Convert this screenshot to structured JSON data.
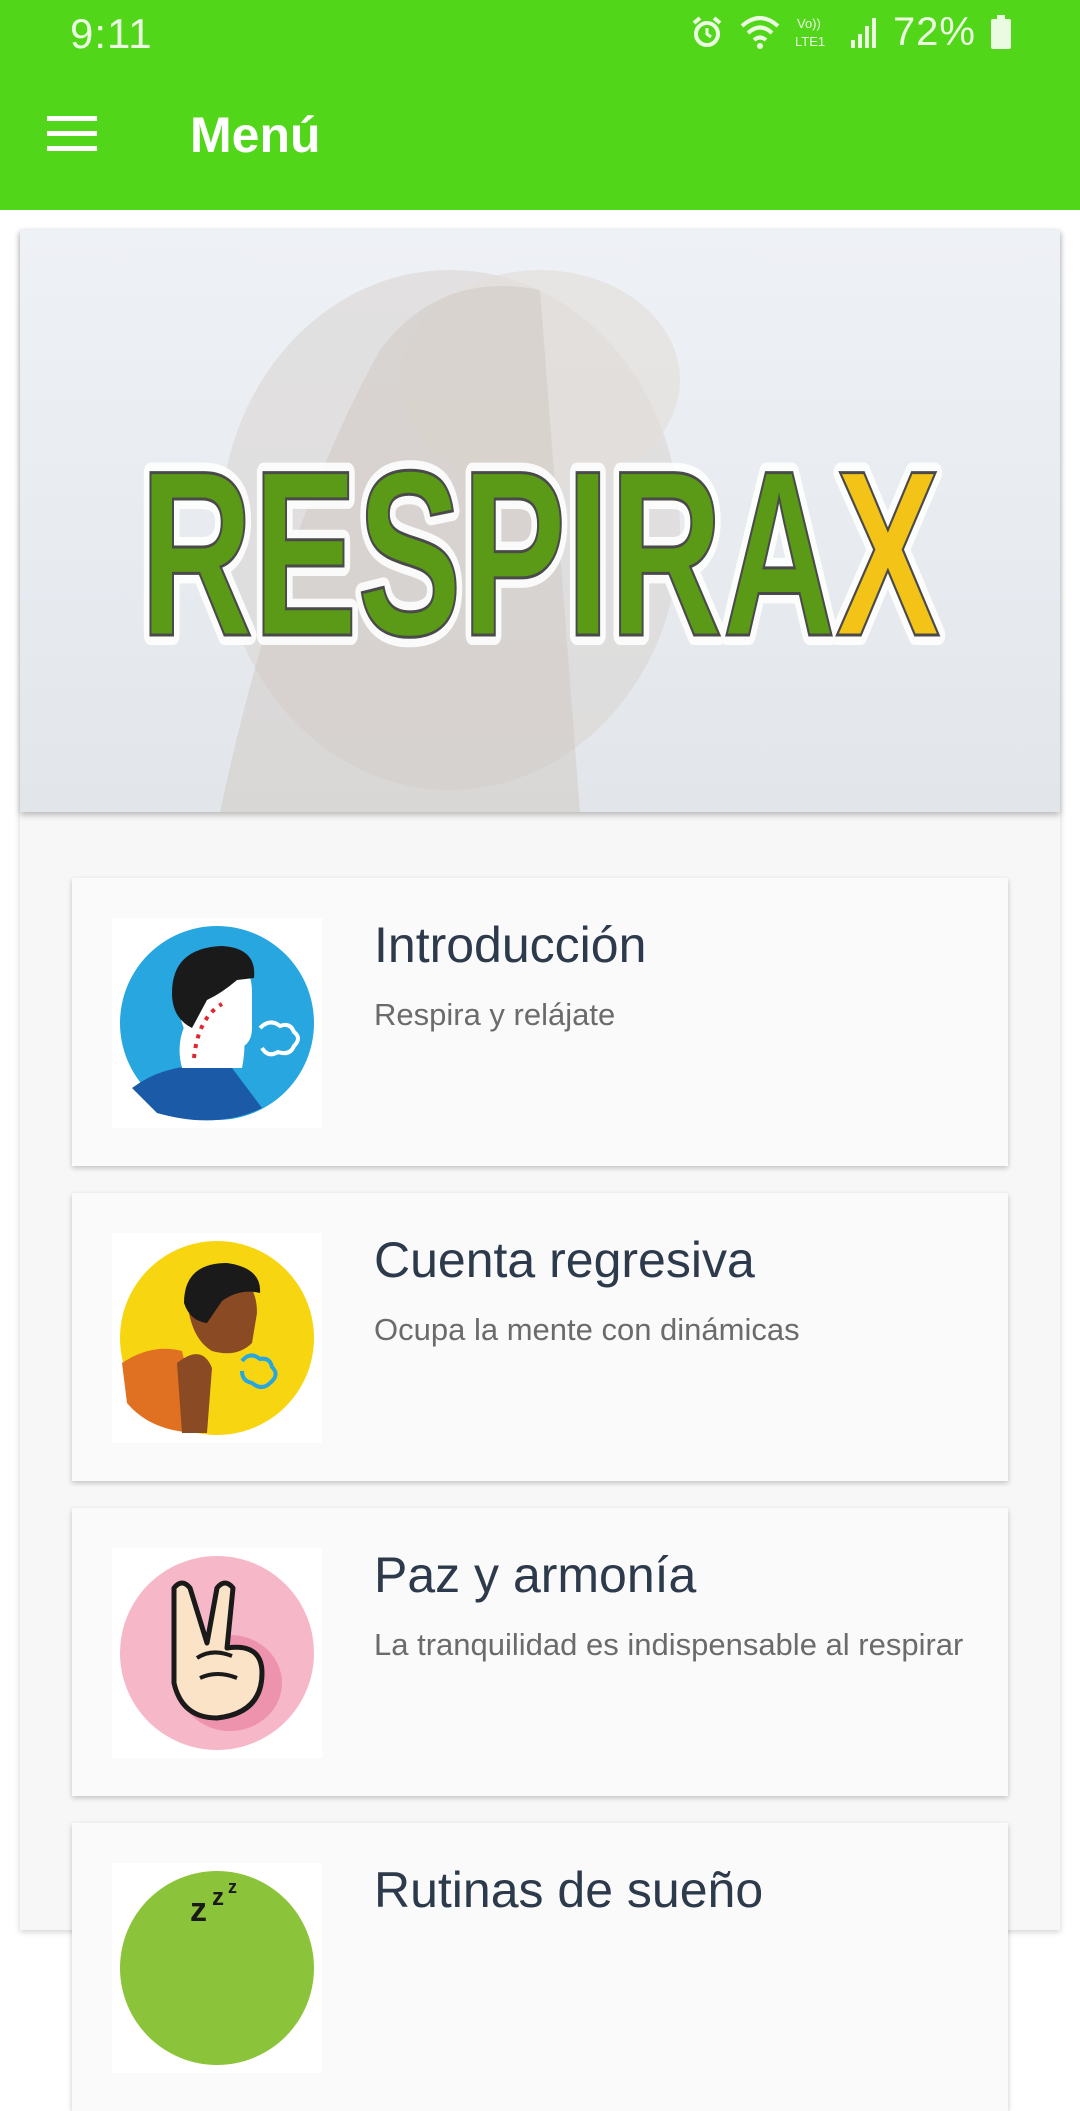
{
  "status_bar": {
    "time": "9:11",
    "battery": "72%",
    "network_label": "Vo)) LTE1",
    "icons": [
      "alarm-icon",
      "wifi-icon",
      "volte-icon",
      "signal-icon",
      "battery-icon"
    ]
  },
  "app_bar": {
    "title": "Menú",
    "menu_icon": "hamburger-menu-icon"
  },
  "banner": {
    "logo_text_green": "RESPIRA",
    "logo_text_yellow": "X",
    "colors": {
      "green": "#5a9a16",
      "yellow": "#f3c417"
    }
  },
  "menu_items": [
    {
      "title": "Introducción",
      "subtitle": "Respira y relájate",
      "icon": "person-exhaling-icon",
      "icon_bg": "#27a6e0"
    },
    {
      "title": "Cuenta regresiva",
      "subtitle": "Ocupa la mente con dinámicas",
      "icon": "person-breathing-icon",
      "icon_bg": "#f7d611"
    },
    {
      "title": "Paz y armonía",
      "subtitle": "La tranquilidad es indispensable al respirar",
      "icon": "peace-hand-icon",
      "icon_bg": "#f6b8c8"
    },
    {
      "title": "Rutinas de sueño",
      "subtitle": "",
      "icon": "sleep-icon",
      "icon_bg": "#8bc43a"
    }
  ],
  "colors": {
    "accent": "#52d61a",
    "title_text": "#2c3a4b",
    "subtitle_text": "#6b6b6b"
  }
}
